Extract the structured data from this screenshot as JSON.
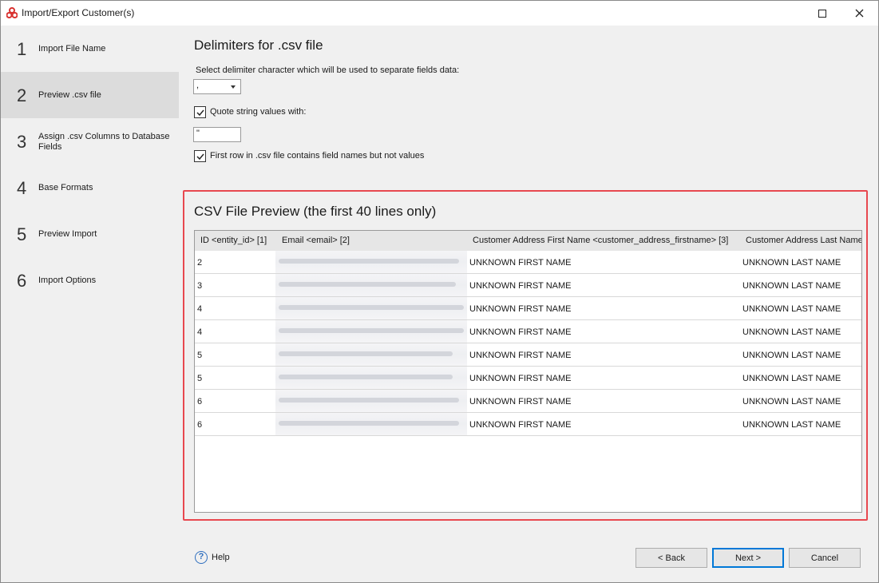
{
  "window": {
    "title": "Import/Export Customer(s)"
  },
  "steps": [
    {
      "num": "1",
      "label": "Import File Name"
    },
    {
      "num": "2",
      "label": "Preview .csv file",
      "active": true
    },
    {
      "num": "3",
      "label": "Assign .csv Columns to Database Fields"
    },
    {
      "num": "4",
      "label": "Base Formats"
    },
    {
      "num": "5",
      "label": "Preview Import"
    },
    {
      "num": "6",
      "label": "Import Options"
    }
  ],
  "delimiters": {
    "heading": "Delimiters for .csv file",
    "caption": "Select delimiter character which will be used to separate fields data:",
    "delimiter_value": ",",
    "quote_label": "Quote string values with:",
    "quote_checked": true,
    "quote_value": "\"",
    "first_row_label": "First row in .csv file contains field names but not values",
    "first_row_checked": true
  },
  "preview": {
    "heading": "CSV File Preview (the first 40 lines only)",
    "columns": [
      "ID <entity_id> [1]",
      "Email <email> [2]",
      "Customer Address First Name <customer_address_firstname> [3]",
      "Customer Address Last Name"
    ],
    "rows": [
      {
        "id": "2",
        "first": "UNKNOWN FIRST NAME",
        "last": "UNKNOWN LAST NAME"
      },
      {
        "id": "3",
        "first": "UNKNOWN FIRST NAME",
        "last": "UNKNOWN LAST NAME"
      },
      {
        "id": "4",
        "first": "UNKNOWN FIRST NAME",
        "last": "UNKNOWN LAST NAME"
      },
      {
        "id": "4",
        "first": "UNKNOWN FIRST NAME",
        "last": "UNKNOWN LAST NAME"
      },
      {
        "id": "5",
        "first": "UNKNOWN FIRST NAME",
        "last": "UNKNOWN LAST NAME"
      },
      {
        "id": "5",
        "first": "UNKNOWN FIRST NAME",
        "last": "UNKNOWN LAST NAME"
      },
      {
        "id": "6",
        "first": "UNKNOWN FIRST NAME",
        "last": "UNKNOWN LAST NAME"
      },
      {
        "id": "6",
        "first": "UNKNOWN FIRST NAME",
        "last": "UNKNOWN LAST NAME"
      }
    ]
  },
  "footer": {
    "help_label": "Help",
    "back_label": "< Back",
    "next_label": "Next >",
    "cancel_label": "Cancel"
  },
  "colors": {
    "highlight": "#e8484f",
    "app_icon": "#d8312f",
    "help_icon": "#2f6fbf"
  }
}
